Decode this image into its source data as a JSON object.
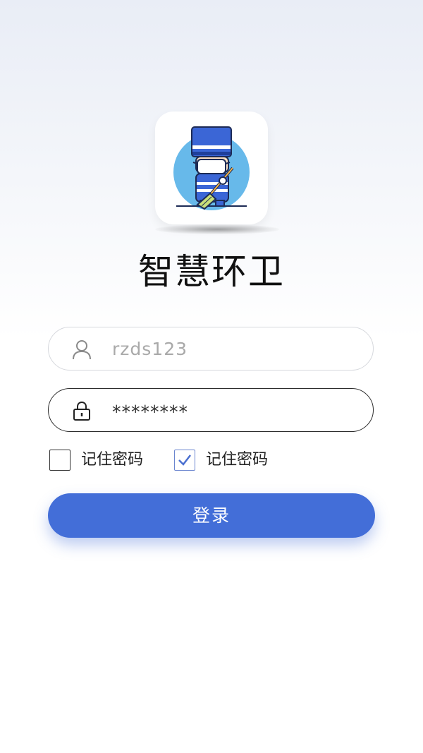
{
  "app": {
    "title": "智慧环卫",
    "logo_icon": "sanitation-worker-icon"
  },
  "login_form": {
    "username": {
      "value": "rzds123",
      "icon": "user-icon"
    },
    "password": {
      "value": "********",
      "icon": "lock-icon"
    },
    "options": [
      {
        "label": "记住密码",
        "checked": false
      },
      {
        "label": "记住密码",
        "checked": true
      }
    ],
    "submit_label": "登录"
  },
  "colors": {
    "accent": "#436ed8",
    "checkbox_checked": "#4a6fd0",
    "placeholder_text": "#a9a9a9"
  }
}
